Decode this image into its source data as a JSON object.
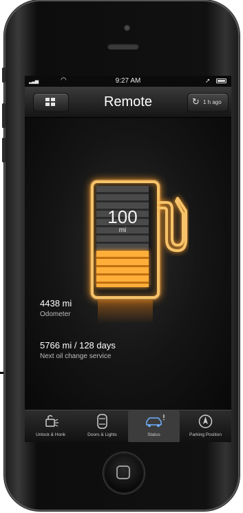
{
  "status_bar": {
    "time": "9:27 AM"
  },
  "nav": {
    "title": "Remote",
    "refresh_label": "1 h ago"
  },
  "fuel": {
    "range_value": "100",
    "range_unit": "mi",
    "fill_fraction": 0.36
  },
  "stats": [
    {
      "value": "4438 mi",
      "label": "Odometer"
    },
    {
      "value": "5766 mi / 128 days",
      "label": "Next oil change service"
    }
  ],
  "tabs": [
    {
      "label": "Unlock & Honk",
      "icon": "unlock-honk-icon",
      "active": false
    },
    {
      "label": "Doors & Lights",
      "icon": "car-top-icon",
      "active": false
    },
    {
      "label": "Status",
      "icon": "car-status-icon",
      "active": true
    },
    {
      "label": "Parking Position",
      "icon": "compass-icon",
      "active": false
    }
  ],
  "colors": {
    "accent": "#f6a93a",
    "glow": "#ff9e2a"
  }
}
